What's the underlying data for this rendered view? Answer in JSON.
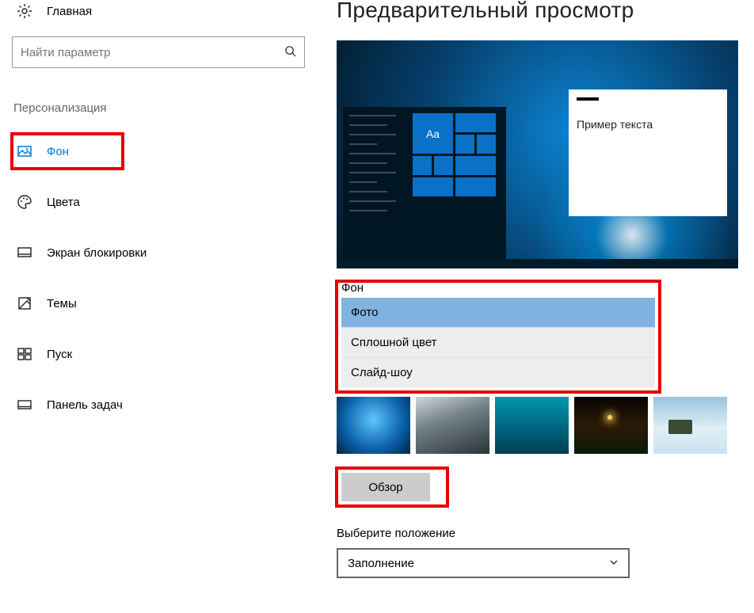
{
  "sidebar": {
    "home_label": "Главная",
    "search_placeholder": "Найти параметр",
    "category_title": "Персонализация",
    "items": [
      {
        "label": "Фон",
        "icon": "picture-icon",
        "active": true
      },
      {
        "label": "Цвета",
        "icon": "palette-icon",
        "active": false
      },
      {
        "label": "Экран блокировки",
        "icon": "lockscreen-icon",
        "active": false
      },
      {
        "label": "Темы",
        "icon": "themes-icon",
        "active": false
      },
      {
        "label": "Пуск",
        "icon": "start-icon",
        "active": false
      },
      {
        "label": "Панель задач",
        "icon": "taskbar-icon",
        "active": false
      }
    ]
  },
  "main": {
    "preview_title": "Предварительный просмотр",
    "preview_sample_text": "Пример текста",
    "preview_tile_text": "Aa",
    "background_section_label": "Фон",
    "background_options": [
      {
        "label": "Фото",
        "selected": true
      },
      {
        "label": "Сплошной цвет",
        "selected": false
      },
      {
        "label": "Слайд-шоу",
        "selected": false
      }
    ],
    "browse_button_label": "Обзор",
    "fit_label": "Выберите положение",
    "fit_value": "Заполнение"
  },
  "annotations": {
    "highlighted": [
      "nav-item-background",
      "background-dropdown",
      "browse-button"
    ]
  }
}
